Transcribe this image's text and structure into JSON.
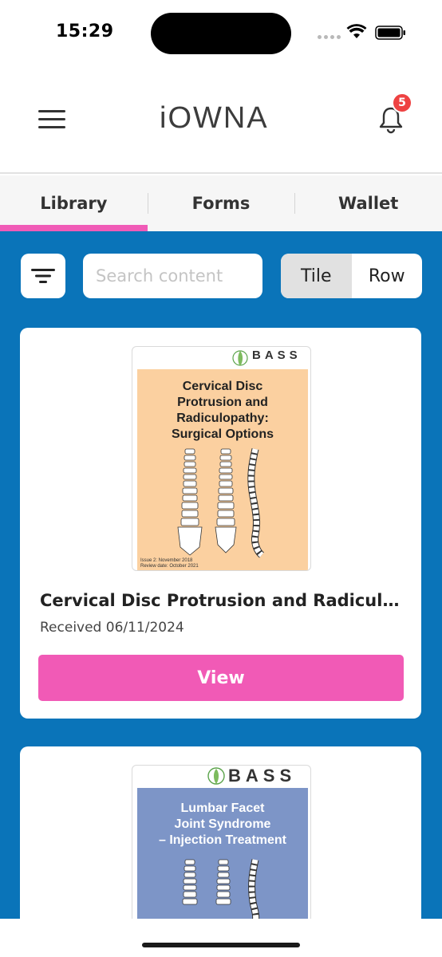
{
  "status": {
    "time": "15:29"
  },
  "header": {
    "logo": "iOWNA",
    "notification_count": "5"
  },
  "tabs": [
    {
      "label": "Library",
      "active": true
    },
    {
      "label": "Forms",
      "active": false
    },
    {
      "label": "Wallet",
      "active": false
    }
  ],
  "toolbar": {
    "search_placeholder": "Search content",
    "view_toggle": {
      "tile": "Tile",
      "row": "Row",
      "selected": "Tile"
    }
  },
  "cards": [
    {
      "cover_org": "BASS",
      "cover_title_lines": [
        "Cervical Disc",
        "Protrusion and",
        "Radiculopathy:",
        "Surgical Options"
      ],
      "cover_color": "#fbd0a0",
      "title": "Cervical Disc Protrusion and Radiculopathy: Surgical Options",
      "date": "Received 06/11/2024",
      "button": "View"
    },
    {
      "cover_org": "BASS",
      "cover_title_lines": [
        "Lumbar Facet",
        "Joint Syndrome",
        "– Injection Treatment"
      ],
      "cover_color": "#7d95c7"
    }
  ],
  "colors": {
    "accent": "#f15ab6",
    "background": "#0a74b9",
    "badge": "#ee4242"
  }
}
